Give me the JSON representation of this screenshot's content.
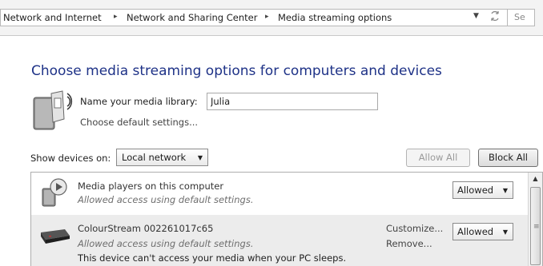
{
  "breadcrumb": {
    "items": [
      "Network and Internet",
      "Network and Sharing Center",
      "Media streaming options"
    ],
    "separator": "▸",
    "search_placeholder": "Se"
  },
  "page": {
    "title": "Choose media streaming options for computers and devices"
  },
  "library": {
    "label": "Name your media library:",
    "value": "Julia",
    "default_link": "Choose default settings..."
  },
  "show_devices": {
    "label": "Show devices on:",
    "selected": "Local network"
  },
  "buttons": {
    "allow_all": "Allow All",
    "block_all": "Block All"
  },
  "devices": [
    {
      "title": "Media players on this computer",
      "subtitle": "Allowed access using default settings.",
      "status": "Allowed"
    },
    {
      "title": "ColourStream 002261017c65",
      "subtitle": "Allowed access using default settings.",
      "note": "This device can't access your media when your PC sleeps.",
      "customize": "Customize...",
      "remove": "Remove...",
      "status": "Allowed"
    }
  ],
  "colors": {
    "title_blue": "#1e3287",
    "selected_row": "#ececec"
  },
  "icons": {
    "arrow": "chevron-down-icon",
    "refresh": "refresh-icon",
    "library": "media-library-icon",
    "media_player": "media-player-icon",
    "device": "device-icon"
  }
}
